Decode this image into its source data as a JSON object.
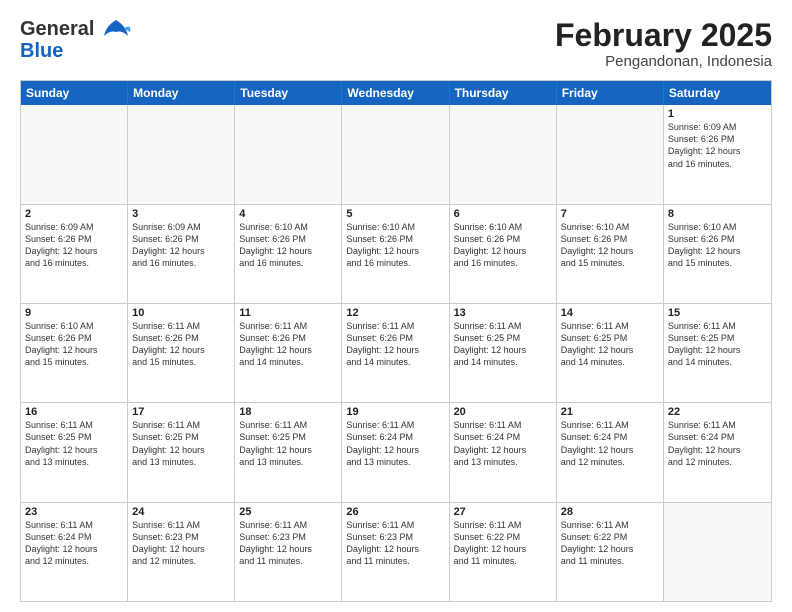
{
  "header": {
    "logo_general": "General",
    "logo_blue": "Blue",
    "month_title": "February 2025",
    "location": "Pengandonan, Indonesia"
  },
  "weekdays": [
    "Sunday",
    "Monday",
    "Tuesday",
    "Wednesday",
    "Thursday",
    "Friday",
    "Saturday"
  ],
  "rows": [
    [
      {
        "day": "",
        "info": ""
      },
      {
        "day": "",
        "info": ""
      },
      {
        "day": "",
        "info": ""
      },
      {
        "day": "",
        "info": ""
      },
      {
        "day": "",
        "info": ""
      },
      {
        "day": "",
        "info": ""
      },
      {
        "day": "1",
        "info": "Sunrise: 6:09 AM\nSunset: 6:26 PM\nDaylight: 12 hours\nand 16 minutes."
      }
    ],
    [
      {
        "day": "2",
        "info": "Sunrise: 6:09 AM\nSunset: 6:26 PM\nDaylight: 12 hours\nand 16 minutes."
      },
      {
        "day": "3",
        "info": "Sunrise: 6:09 AM\nSunset: 6:26 PM\nDaylight: 12 hours\nand 16 minutes."
      },
      {
        "day": "4",
        "info": "Sunrise: 6:10 AM\nSunset: 6:26 PM\nDaylight: 12 hours\nand 16 minutes."
      },
      {
        "day": "5",
        "info": "Sunrise: 6:10 AM\nSunset: 6:26 PM\nDaylight: 12 hours\nand 16 minutes."
      },
      {
        "day": "6",
        "info": "Sunrise: 6:10 AM\nSunset: 6:26 PM\nDaylight: 12 hours\nand 16 minutes."
      },
      {
        "day": "7",
        "info": "Sunrise: 6:10 AM\nSunset: 6:26 PM\nDaylight: 12 hours\nand 15 minutes."
      },
      {
        "day": "8",
        "info": "Sunrise: 6:10 AM\nSunset: 6:26 PM\nDaylight: 12 hours\nand 15 minutes."
      }
    ],
    [
      {
        "day": "9",
        "info": "Sunrise: 6:10 AM\nSunset: 6:26 PM\nDaylight: 12 hours\nand 15 minutes."
      },
      {
        "day": "10",
        "info": "Sunrise: 6:11 AM\nSunset: 6:26 PM\nDaylight: 12 hours\nand 15 minutes."
      },
      {
        "day": "11",
        "info": "Sunrise: 6:11 AM\nSunset: 6:26 PM\nDaylight: 12 hours\nand 14 minutes."
      },
      {
        "day": "12",
        "info": "Sunrise: 6:11 AM\nSunset: 6:26 PM\nDaylight: 12 hours\nand 14 minutes."
      },
      {
        "day": "13",
        "info": "Sunrise: 6:11 AM\nSunset: 6:25 PM\nDaylight: 12 hours\nand 14 minutes."
      },
      {
        "day": "14",
        "info": "Sunrise: 6:11 AM\nSunset: 6:25 PM\nDaylight: 12 hours\nand 14 minutes."
      },
      {
        "day": "15",
        "info": "Sunrise: 6:11 AM\nSunset: 6:25 PM\nDaylight: 12 hours\nand 14 minutes."
      }
    ],
    [
      {
        "day": "16",
        "info": "Sunrise: 6:11 AM\nSunset: 6:25 PM\nDaylight: 12 hours\nand 13 minutes."
      },
      {
        "day": "17",
        "info": "Sunrise: 6:11 AM\nSunset: 6:25 PM\nDaylight: 12 hours\nand 13 minutes."
      },
      {
        "day": "18",
        "info": "Sunrise: 6:11 AM\nSunset: 6:25 PM\nDaylight: 12 hours\nand 13 minutes."
      },
      {
        "day": "19",
        "info": "Sunrise: 6:11 AM\nSunset: 6:24 PM\nDaylight: 12 hours\nand 13 minutes."
      },
      {
        "day": "20",
        "info": "Sunrise: 6:11 AM\nSunset: 6:24 PM\nDaylight: 12 hours\nand 13 minutes."
      },
      {
        "day": "21",
        "info": "Sunrise: 6:11 AM\nSunset: 6:24 PM\nDaylight: 12 hours\nand 12 minutes."
      },
      {
        "day": "22",
        "info": "Sunrise: 6:11 AM\nSunset: 6:24 PM\nDaylight: 12 hours\nand 12 minutes."
      }
    ],
    [
      {
        "day": "23",
        "info": "Sunrise: 6:11 AM\nSunset: 6:24 PM\nDaylight: 12 hours\nand 12 minutes."
      },
      {
        "day": "24",
        "info": "Sunrise: 6:11 AM\nSunset: 6:23 PM\nDaylight: 12 hours\nand 12 minutes."
      },
      {
        "day": "25",
        "info": "Sunrise: 6:11 AM\nSunset: 6:23 PM\nDaylight: 12 hours\nand 11 minutes."
      },
      {
        "day": "26",
        "info": "Sunrise: 6:11 AM\nSunset: 6:23 PM\nDaylight: 12 hours\nand 11 minutes."
      },
      {
        "day": "27",
        "info": "Sunrise: 6:11 AM\nSunset: 6:22 PM\nDaylight: 12 hours\nand 11 minutes."
      },
      {
        "day": "28",
        "info": "Sunrise: 6:11 AM\nSunset: 6:22 PM\nDaylight: 12 hours\nand 11 minutes."
      },
      {
        "day": "",
        "info": ""
      }
    ]
  ]
}
